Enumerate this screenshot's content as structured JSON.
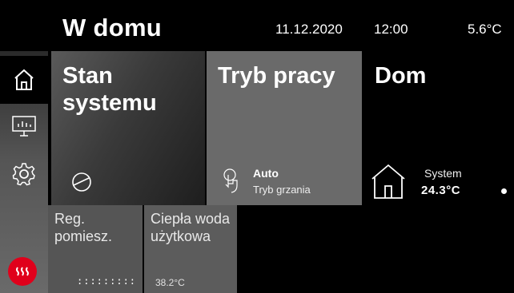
{
  "header": {
    "title": "W domu",
    "date": "11.12.2020",
    "time": "12:00",
    "outdoor_temp": "5.6°C"
  },
  "sidebar": {
    "items": [
      {
        "icon": "home-icon",
        "active": true
      },
      {
        "icon": "monitor-chart-icon",
        "active": false
      },
      {
        "icon": "gear-icon",
        "active": false
      }
    ]
  },
  "tiles": {
    "system": {
      "title": "Stan systemu",
      "icon": "compressor-icon"
    },
    "mode": {
      "title": "Tryb pracy",
      "value": "Auto",
      "subtitle": "Tryb grzania",
      "icon": "touch-icon"
    },
    "home": {
      "title": "Dom",
      "label": "System",
      "value": "24.3°C",
      "icon": "house-icon"
    },
    "reg": {
      "title": "Reg. pomiesz.",
      "grip": ":::::::::"
    },
    "water": {
      "title": "Ciepła woda użytkowa",
      "value": "38.2°C"
    }
  },
  "colors": {
    "accent_red": "#e0001b",
    "background": "#000000"
  }
}
